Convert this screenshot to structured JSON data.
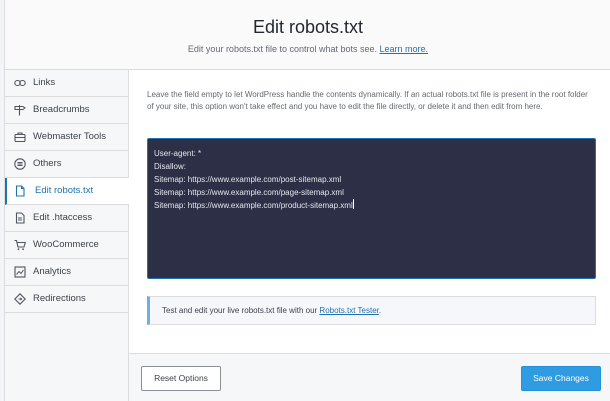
{
  "header": {
    "title": "Edit robots.txt",
    "subtitle": "Edit your robots.txt file to control what bots see.",
    "learn_more": "Learn more."
  },
  "sidebar": {
    "items": [
      {
        "label": "Links",
        "icon": "link-icon"
      },
      {
        "label": "Breadcrumbs",
        "icon": "signpost-icon"
      },
      {
        "label": "Webmaster Tools",
        "icon": "briefcase-icon"
      },
      {
        "label": "Others",
        "icon": "list-circle-icon"
      },
      {
        "label": "Edit robots.txt",
        "icon": "file-icon",
        "active": true
      },
      {
        "label": "Edit .htaccess",
        "icon": "document-icon"
      },
      {
        "label": "WooCommerce",
        "icon": "cart-icon"
      },
      {
        "label": "Analytics",
        "icon": "chart-icon"
      },
      {
        "label": "Redirections",
        "icon": "redirect-icon"
      }
    ]
  },
  "main": {
    "description": "Leave the field empty to let WordPress handle the contents dynamically. If an actual robots.txt file is present in the root folder of your site, this option won't take effect and you have to edit the file directly, or delete it and then edit from here.",
    "editor_lines": [
      "User-agent: *",
      "Disallow:",
      "Sitemap: https://www.example.com/post-sitemap.xml",
      "Sitemap: https://www.example.com/page-sitemap.xml",
      "Sitemap: https://www.example.com/product-sitemap.xml"
    ],
    "notice_text": "Test and edit your live robots.txt file with our",
    "notice_link": "Robots.txt Tester",
    "notice_end": "."
  },
  "footer": {
    "reset_label": "Reset Options",
    "save_label": "Save Changes"
  },
  "colors": {
    "accent": "#2271b1",
    "editor_bg": "#2c2f45",
    "save_button": "#2f9be0"
  }
}
